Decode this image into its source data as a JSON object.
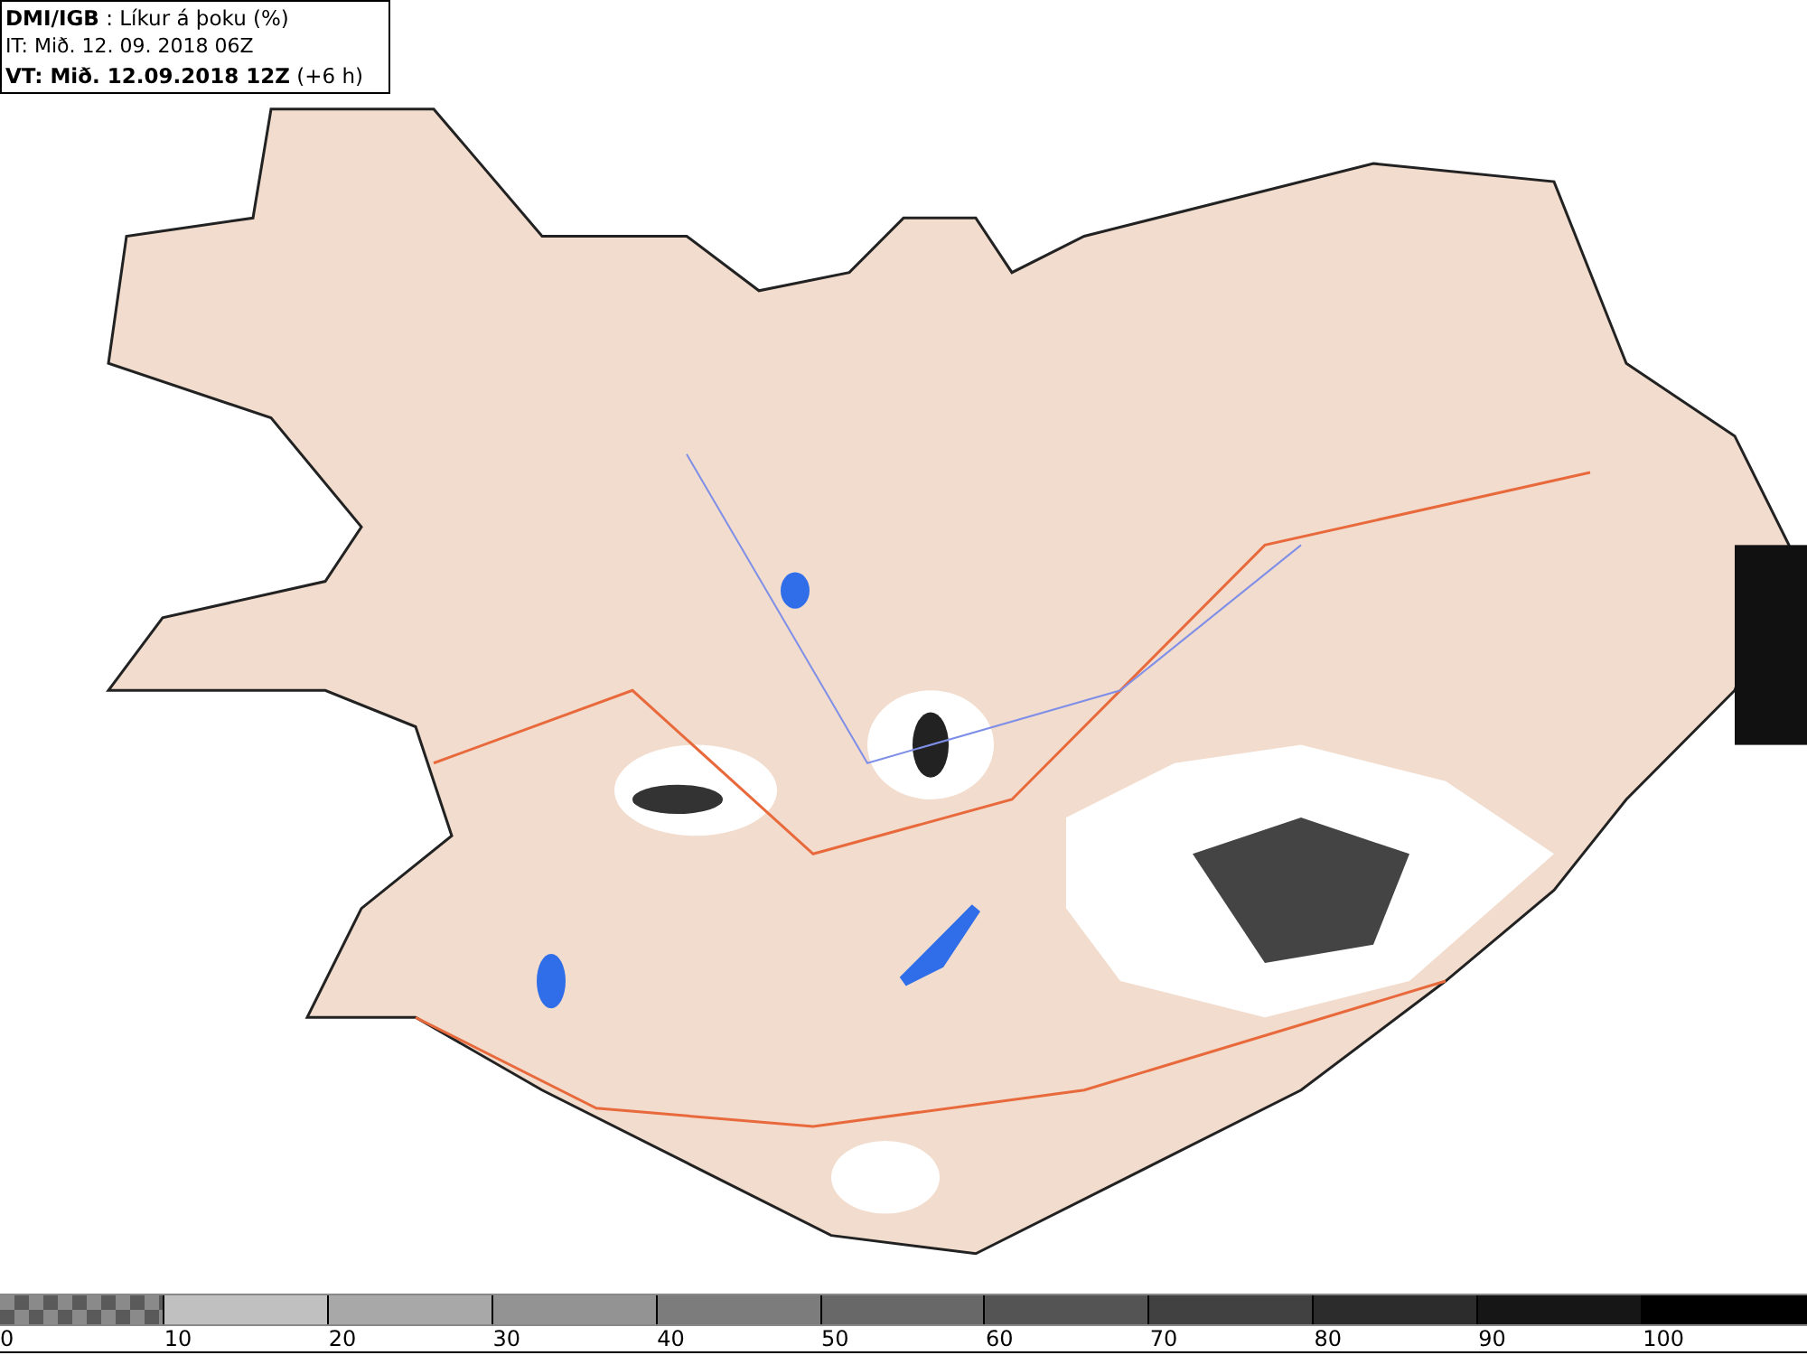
{
  "header": {
    "lines": [
      "**DMI/IGB** : Líkur á þoku (%)",
      "IT: Mið. 12. 09. 2018 06Z",
      "**VT: Mið. 12.09.2018 12Z** (+6 h)"
    ]
  },
  "legend": {
    "segments": [
      {
        "kind": "checker",
        "color": "#5a5a5a"
      },
      {
        "kind": "solid",
        "color": "#c0c0c0"
      },
      {
        "kind": "solid",
        "color": "#a8a8a8"
      },
      {
        "kind": "solid",
        "color": "#939393"
      },
      {
        "kind": "solid",
        "color": "#7c7c7c"
      },
      {
        "kind": "solid",
        "color": "#686868"
      },
      {
        "kind": "solid",
        "color": "#545454"
      },
      {
        "kind": "solid",
        "color": "#414141"
      },
      {
        "kind": "solid",
        "color": "#2c2c2c"
      },
      {
        "kind": "solid",
        "color": "#161616"
      },
      {
        "kind": "solid",
        "color": "#000000"
      }
    ],
    "labels": [
      "0",
      "10",
      "20",
      "30",
      "40",
      "50",
      "60",
      "70",
      "80",
      "90",
      "100"
    ]
  }
}
